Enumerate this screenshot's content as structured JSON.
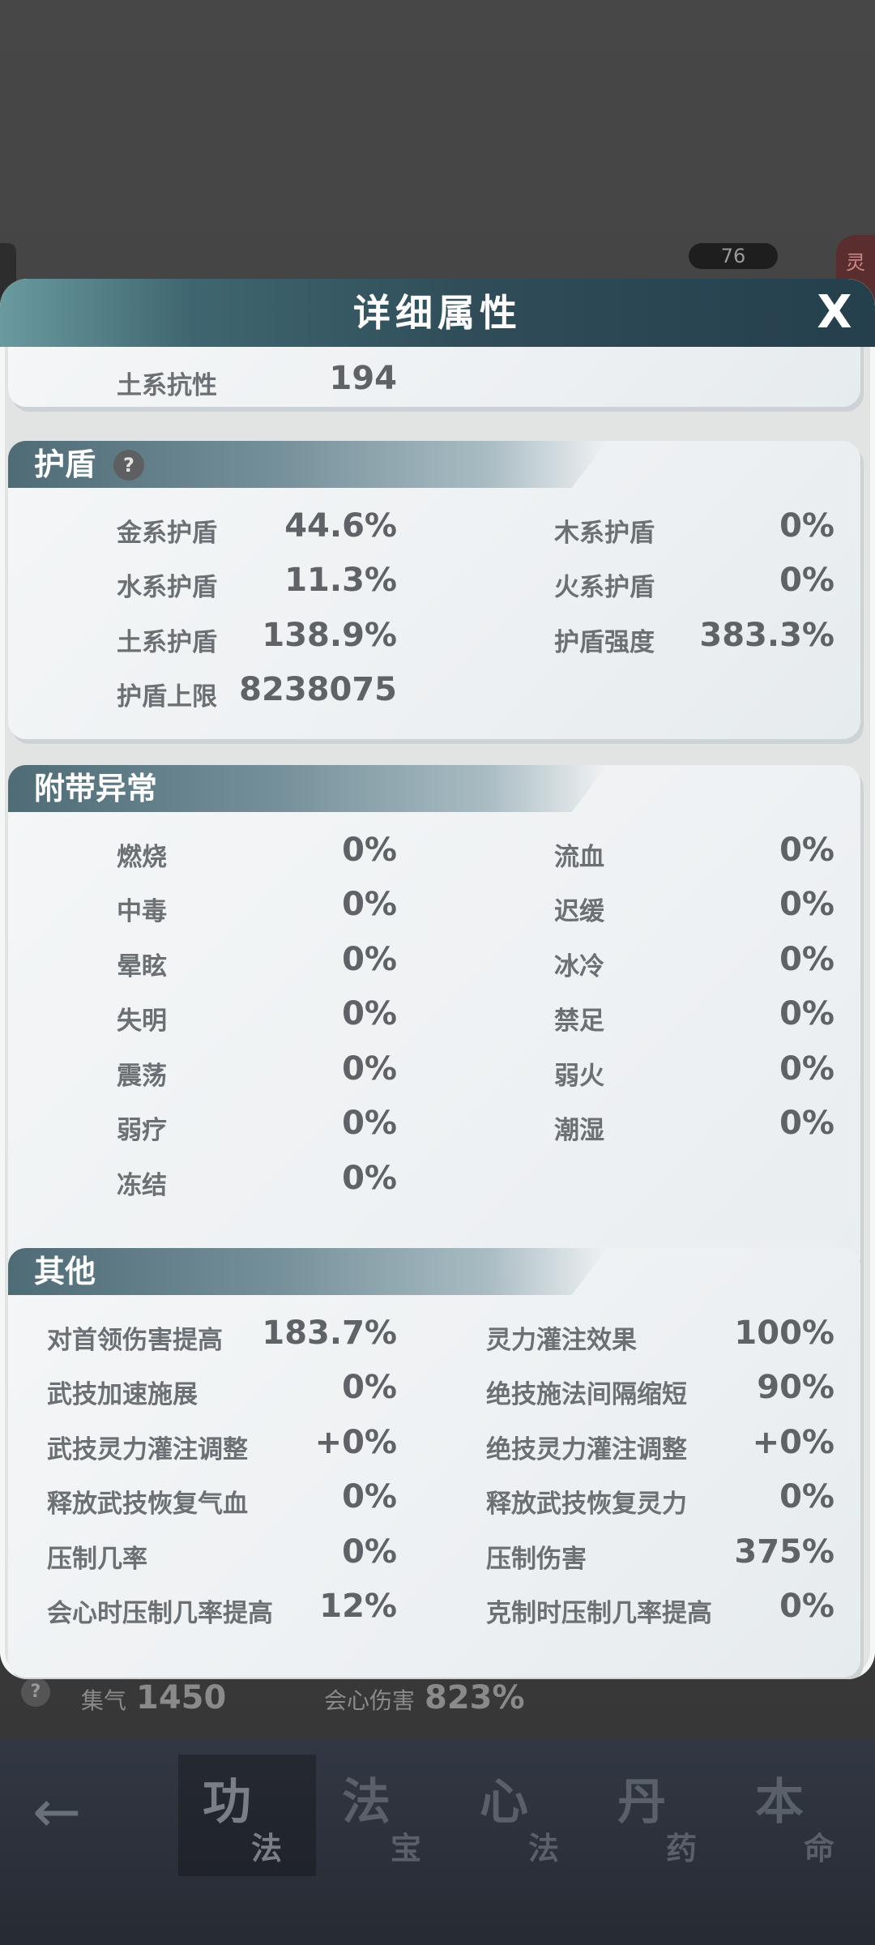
{
  "modal": {
    "title": "详细属性",
    "close_label": "X"
  },
  "background": {
    "level": "76",
    "spirit_tab": "灵",
    "stats": {
      "help": "?",
      "energy_label": "集气",
      "energy_value": "1450",
      "crit_damage_label": "会心伤害",
      "crit_damage_value": "823%"
    }
  },
  "partial_row": {
    "label": "土系抗性",
    "value": "194"
  },
  "shield": {
    "title": "护盾",
    "help": "?",
    "rows": [
      {
        "left_label": "金系护盾",
        "left_value": "44.6%",
        "right_label": "木系护盾",
        "right_value": "0%"
      },
      {
        "left_label": "水系护盾",
        "left_value": "11.3%",
        "right_label": "火系护盾",
        "right_value": "0%"
      },
      {
        "left_label": "土系护盾",
        "left_value": "138.9%",
        "right_label": "护盾强度",
        "right_value": "383.3%"
      },
      {
        "left_label": "护盾上限",
        "left_value": "8238075",
        "right_label": "",
        "right_value": ""
      }
    ]
  },
  "ailment": {
    "title": "附带异常",
    "rows": [
      {
        "left_label": "燃烧",
        "left_value": "0%",
        "right_label": "流血",
        "right_value": "0%"
      },
      {
        "left_label": "中毒",
        "left_value": "0%",
        "right_label": "迟缓",
        "right_value": "0%"
      },
      {
        "left_label": "晕眩",
        "left_value": "0%",
        "right_label": "冰冷",
        "right_value": "0%"
      },
      {
        "left_label": "失明",
        "left_value": "0%",
        "right_label": "禁足",
        "right_value": "0%"
      },
      {
        "left_label": "震荡",
        "left_value": "0%",
        "right_label": "弱火",
        "right_value": "0%"
      },
      {
        "left_label": "弱疗",
        "left_value": "0%",
        "right_label": "潮湿",
        "right_value": "0%"
      },
      {
        "left_label": "冻结",
        "left_value": "0%",
        "right_label": "",
        "right_value": ""
      }
    ]
  },
  "other": {
    "title": "其他",
    "rows": [
      {
        "left_label": "对首领伤害提高",
        "left_value": "183.7%",
        "right_label": "灵力灌注效果",
        "right_value": "100%"
      },
      {
        "left_label": "武技加速施展",
        "left_value": "0%",
        "right_label": "绝技施法间隔缩短",
        "right_value": "90%"
      },
      {
        "left_label": "武技灵力灌注调整",
        "left_value": "+0%",
        "right_label": "绝技灵力灌注调整",
        "right_value": "+0%"
      },
      {
        "left_label": "释放武技恢复气血",
        "left_value": "0%",
        "right_label": "释放武技恢复灵力",
        "right_value": "0%"
      },
      {
        "left_label": "压制几率",
        "left_value": "0%",
        "right_label": "压制伤害",
        "right_value": "375%"
      },
      {
        "left_label": "会心时压制几率提高",
        "left_value": "12%",
        "right_label": "克制时压制几率提高",
        "right_value": "0%"
      }
    ]
  },
  "nav": {
    "back": "←",
    "tabs": [
      {
        "big": "功",
        "small": "法"
      },
      {
        "big": "法",
        "small": "宝"
      },
      {
        "big": "心",
        "small": "法"
      },
      {
        "big": "丹",
        "small": "药"
      },
      {
        "big": "本",
        "small": "命"
      }
    ]
  }
}
